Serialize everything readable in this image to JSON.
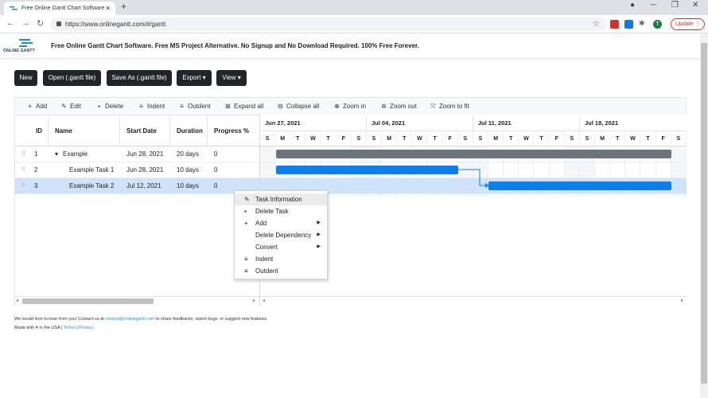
{
  "browser": {
    "tab_title": "Free Online Gantt Chart Software",
    "url": "https://www.onlinegantt.com/#/gantt",
    "update_label": "Update",
    "profile_initial": "T"
  },
  "app": {
    "logo_text": "ONLINE GANTT",
    "headline": "Free Online Gantt Chart Software. Free MS Project Alternative. No Signup and No Download Required. 100% Free Forever."
  },
  "actions": {
    "new": "New",
    "open": "Open (.gantt file)",
    "save_as": "Save As (.gantt file)",
    "export": "Export ▾",
    "view": "View ▾"
  },
  "gantt_toolbar": {
    "add": "Add",
    "edit": "Edit",
    "delete": "Delete",
    "indent": "Indent",
    "outdent": "Outdent",
    "expand_all": "Expand all",
    "collapse_all": "Collapse all",
    "zoom_in": "Zoom in",
    "zoom_out": "Zoom out",
    "zoom_to_fit": "Zoom to fit"
  },
  "grid": {
    "headers": {
      "id": "ID",
      "name": "Name",
      "start_date": "Start Date",
      "duration": "Duration",
      "progress": "Progress %"
    },
    "rows": [
      {
        "id": "1",
        "name": "Example",
        "start_date": "Jun 28, 2021",
        "duration": "20 days",
        "progress": "0"
      },
      {
        "id": "2",
        "name": "Example Task 1",
        "start_date": "Jun 28, 2021",
        "duration": "10 days",
        "progress": "0"
      },
      {
        "id": "3",
        "name": "Example Task 2",
        "start_date": "Jul 12, 2021",
        "duration": "10 days",
        "progress": "0"
      }
    ]
  },
  "timeline": {
    "weeks": [
      "Jun 27, 2021",
      "Jul 04, 2021",
      "Jul 11, 2021",
      "Jul 18, 2021"
    ],
    "day_letters": [
      "S",
      "M",
      "T",
      "W",
      "T",
      "F",
      "S"
    ]
  },
  "context_menu": {
    "task_information": "Task Information",
    "delete_task": "Delete Task",
    "add": "Add",
    "delete_dependency": "Delete Dependency",
    "convert": "Convert",
    "indent": "Indent",
    "outdent": "Outdent"
  },
  "footer": {
    "line1_prefix": "We would love to hear from you! Contact us at ",
    "email": "contact@onlinegantt.com",
    "line1_suffix": " to share feedbacks, report bugs, or suggest new features.",
    "line2_prefix": "Made with",
    "heart": "♥",
    "line2_mid": "in the USA |",
    "terms": "Terms",
    "sep": "|",
    "privacy": "Privacy"
  },
  "colors": {
    "summary_bar": "#6c757d",
    "task_bar": "#0d7fea",
    "dark_button": "#212529",
    "selection": "#cfe3fb"
  }
}
